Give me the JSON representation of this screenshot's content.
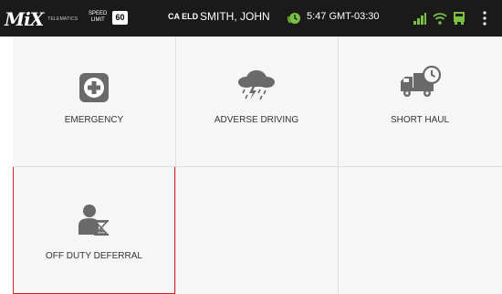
{
  "status_bar": {
    "brand_logo": "MiX",
    "brand_sub": "TELEMATICS",
    "speed_label_line1": "SPEED",
    "speed_label_line2": "LIMIT",
    "speed_value": "60",
    "eld_badge": "CA ELD",
    "driver_name": "SMITH, JOHN",
    "time": "5:47 GMT-03:30",
    "icons": [
      "hos-clock-icon",
      "signal-icon",
      "wifi-icon",
      "truck-icon",
      "overflow-menu-icon"
    ],
    "accent_color": "#7bc043"
  },
  "tiles": [
    {
      "label": "EMERGENCY",
      "icon": "first-aid-icon"
    },
    {
      "label": "ADVERSE DRIVING",
      "icon": "storm-cloud-icon"
    },
    {
      "label": "SHORT HAUL",
      "icon": "truck-clock-icon"
    },
    {
      "label": "OFF DUTY DEFERRAL",
      "icon": "person-hourglass-icon",
      "selected": true
    }
  ],
  "colors": {
    "selected_border": "#d52020",
    "icon_gray": "#6a6a6a"
  }
}
